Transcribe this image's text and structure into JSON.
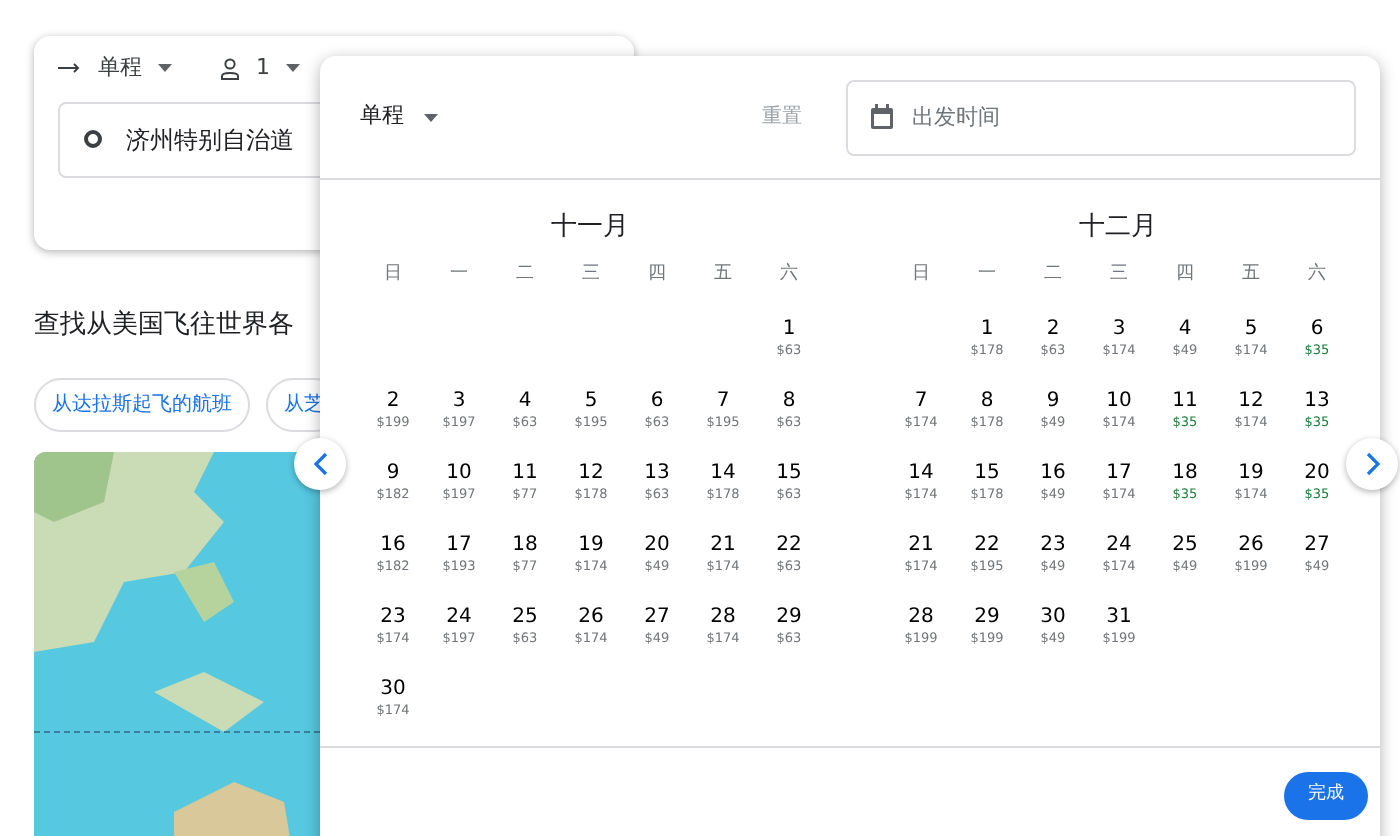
{
  "search_card": {
    "trip_type": "单程",
    "passengers": "1",
    "origin": "济州特别自治道"
  },
  "explore": {
    "heading": "查找从美国飞往世界各",
    "chips": [
      "从达拉斯起飞的航班",
      "从芝"
    ]
  },
  "date_picker": {
    "trip_type": "单程",
    "reset": "重置",
    "date_field": {
      "placeholder": "出发时间"
    },
    "months": [
      {
        "name": "十一月",
        "weekdays": [
          "日",
          "一",
          "二",
          "三",
          "四",
          "五",
          "六"
        ],
        "weeks": [
          [
            {
              "day": "1",
              "price": "$63",
              "low_price": false
            }
          ],
          [
            {
              "day": "2",
              "price": "$199",
              "low_price": false
            },
            {
              "day": "3",
              "price": "$197",
              "low_price": false
            },
            {
              "day": "4",
              "price": "$63",
              "low_price": false
            },
            {
              "day": "5",
              "price": "$195",
              "low_price": false
            },
            {
              "day": "6",
              "price": "$63",
              "low_price": false
            },
            {
              "day": "7",
              "price": "$195",
              "low_price": false
            },
            {
              "day": "8",
              "price": "$63",
              "low_price": false
            }
          ],
          [
            {
              "day": "9",
              "price": "$182",
              "low_price": false
            },
            {
              "day": "10",
              "price": "$197",
              "low_price": false
            },
            {
              "day": "11",
              "price": "$77",
              "low_price": false
            },
            {
              "day": "12",
              "price": "$178",
              "low_price": false
            },
            {
              "day": "13",
              "price": "$63",
              "low_price": false
            },
            {
              "day": "14",
              "price": "$178",
              "low_price": false
            },
            {
              "day": "15",
              "price": "$63",
              "low_price": false
            }
          ],
          [
            {
              "day": "16",
              "price": "$182",
              "low_price": false
            },
            {
              "day": "17",
              "price": "$193",
              "low_price": false
            },
            {
              "day": "18",
              "price": "$77",
              "low_price": false
            },
            {
              "day": "19",
              "price": "$174",
              "low_price": false
            },
            {
              "day": "20",
              "price": "$49",
              "low_price": false
            },
            {
              "day": "21",
              "price": "$174",
              "low_price": false
            },
            {
              "day": "22",
              "price": "$63",
              "low_price": false
            }
          ],
          [
            {
              "day": "23",
              "price": "$174",
              "low_price": false
            },
            {
              "day": "24",
              "price": "$197",
              "low_price": false
            },
            {
              "day": "25",
              "price": "$63",
              "low_price": false
            },
            {
              "day": "26",
              "price": "$174",
              "low_price": false
            },
            {
              "day": "27",
              "price": "$49",
              "low_price": false
            },
            {
              "day": "28",
              "price": "$174",
              "low_price": false
            },
            {
              "day": "29",
              "price": "$63",
              "low_price": false
            }
          ],
          [
            {
              "day": "30",
              "price": "$174",
              "low_price": false
            }
          ]
        ]
      },
      {
        "name": "十二月",
        "weekdays": [
          "日",
          "一",
          "二",
          "三",
          "四",
          "五",
          "六"
        ],
        "weeks": [
          [
            {
              "day": "1",
              "price": "$178",
              "low_price": false
            },
            {
              "day": "2",
              "price": "$63",
              "low_price": false
            },
            {
              "day": "3",
              "price": "$174",
              "low_price": false
            },
            {
              "day": "4",
              "price": "$49",
              "low_price": false
            },
            {
              "day": "5",
              "price": "$174",
              "low_price": false
            },
            {
              "day": "6",
              "price": "$35",
              "low_price": true
            }
          ],
          [
            {
              "day": "7",
              "price": "$174",
              "low_price": false
            },
            {
              "day": "8",
              "price": "$178",
              "low_price": false
            },
            {
              "day": "9",
              "price": "$49",
              "low_price": false
            },
            {
              "day": "10",
              "price": "$174",
              "low_price": false
            },
            {
              "day": "11",
              "price": "$35",
              "low_price": true
            },
            {
              "day": "12",
              "price": "$174",
              "low_price": false
            },
            {
              "day": "13",
              "price": "$35",
              "low_price": true
            }
          ],
          [
            {
              "day": "14",
              "price": "$174",
              "low_price": false
            },
            {
              "day": "15",
              "price": "$178",
              "low_price": false
            },
            {
              "day": "16",
              "price": "$49",
              "low_price": false
            },
            {
              "day": "17",
              "price": "$174",
              "low_price": false
            },
            {
              "day": "18",
              "price": "$35",
              "low_price": true
            },
            {
              "day": "19",
              "price": "$174",
              "low_price": false
            },
            {
              "day": "20",
              "price": "$35",
              "low_price": true
            }
          ],
          [
            {
              "day": "21",
              "price": "$174",
              "low_price": false
            },
            {
              "day": "22",
              "price": "$195",
              "low_price": false
            },
            {
              "day": "23",
              "price": "$49",
              "low_price": false
            },
            {
              "day": "24",
              "price": "$174",
              "low_price": false
            },
            {
              "day": "25",
              "price": "$49",
              "low_price": false
            },
            {
              "day": "26",
              "price": "$199",
              "low_price": false
            },
            {
              "day": "27",
              "price": "$49",
              "low_price": false
            }
          ],
          [
            {
              "day": "28",
              "price": "$199",
              "low_price": false
            },
            {
              "day": "29",
              "price": "$199",
              "low_price": false
            },
            {
              "day": "30",
              "price": "$49",
              "low_price": false
            },
            {
              "day": "31",
              "price": "$199",
              "low_price": false
            }
          ]
        ]
      }
    ],
    "done": "完成"
  }
}
